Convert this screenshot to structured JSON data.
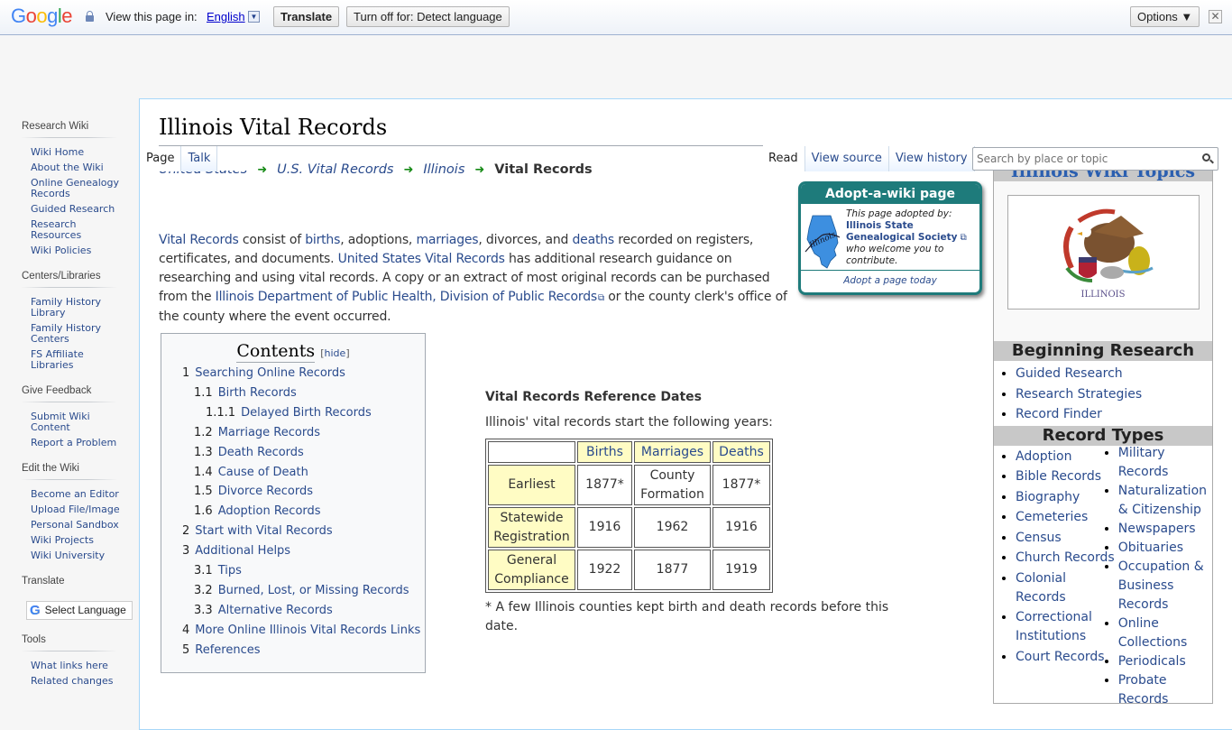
{
  "translate_bar": {
    "logo": [
      "G",
      "o",
      "o",
      "g",
      "l",
      "e"
    ],
    "view_label": "View this page in:",
    "language": "English",
    "dropdown_glyph": "▼",
    "translate_button": "Translate",
    "turn_off_button": "Turn off for: Detect language",
    "options_button": "Options ▼",
    "close_glyph": "✕"
  },
  "sidebar": {
    "sections": [
      {
        "heading": "Research Wiki",
        "items": [
          "Wiki Home",
          "About the Wiki",
          "Online Genealogy Records",
          "Guided Research",
          "Research Resources",
          "Wiki Policies"
        ]
      },
      {
        "heading": "Centers/Libraries",
        "items": [
          "Family History Library",
          "Family History Centers",
          "FS Affiliate Libraries"
        ]
      },
      {
        "heading": "Give Feedback",
        "items": [
          "Submit Wiki Content",
          "Report a Problem"
        ]
      },
      {
        "heading": "Edit the Wiki",
        "items": [
          "Become an Editor",
          "Upload File/Image",
          "Personal Sandbox",
          "Wiki Projects",
          "Wiki University"
        ]
      },
      {
        "heading": "Translate",
        "widget_label": "Select Language"
      },
      {
        "heading": "Tools",
        "items": [
          "What links here",
          "Related changes"
        ]
      }
    ]
  },
  "page": {
    "title": "Illinois Vital Records",
    "tabs_left": [
      "Page",
      "Talk"
    ],
    "tabs_right": [
      "Read",
      "View source",
      "View history"
    ],
    "search_placeholder": "Search by place or topic",
    "breadcrumb": [
      "United States",
      "U.S. Vital Records",
      "Illinois"
    ],
    "breadcrumb_current": "Vital Records",
    "breadcrumb_separator": "➜"
  },
  "intro": {
    "segments": [
      {
        "t": "Vital Records",
        "link": true
      },
      {
        "t": " consist of ",
        "link": false
      },
      {
        "t": "births",
        "link": true
      },
      {
        "t": ", adoptions, ",
        "link": false
      },
      {
        "t": "marriages",
        "link": true
      },
      {
        "t": ", divorces, and ",
        "link": false
      },
      {
        "t": "deaths",
        "link": true
      },
      {
        "t": " recorded on registers, certificates, and documents. ",
        "link": false
      },
      {
        "t": "United States Vital Records",
        "link": true
      },
      {
        "t": " has additional research guidance on researching and using vital records. A copy or an extract of most original records can be purchased from the ",
        "link": false
      },
      {
        "t": "Illinois Department of Public Health, Division of Public Records",
        "link": true,
        "external": true
      },
      {
        "t": " or the county clerk's office of the county where the event occurred.",
        "link": false
      }
    ]
  },
  "adopt": {
    "heading": "Adopt-a-wiki page",
    "line1": "This page adopted by:",
    "org": "Illinois State Genealogical Society",
    "line2": "who welcome you to contribute.",
    "footer": "Adopt a page today",
    "map_color": "#3d8fe0"
  },
  "topics": {
    "heading": "Illinois Wiki Topics",
    "seal_caption": "ILLINOIS",
    "beginning_heading": "Beginning Research",
    "beginning_items": [
      "Guided Research",
      "Research Strategies",
      "Record Finder"
    ],
    "record_types_heading": "Record Types",
    "record_types_col1": [
      "Adoption",
      "Bible Records",
      "Biography",
      "Cemeteries",
      "Census",
      "Church Records",
      "Colonial Records",
      "Correctional Institutions",
      "Court Records"
    ],
    "record_types_col2": [
      "Military Records",
      "Naturalization & Citizenship",
      "Newspapers",
      "Obituaries",
      "Occupation & Business Records",
      "Online Collections",
      "Periodicals",
      "Probate Records"
    ]
  },
  "toc": {
    "title": "Contents",
    "hide_label": "hide",
    "items": [
      {
        "num": "1",
        "label": "Searching Online Records",
        "level": 1
      },
      {
        "num": "1.1",
        "label": "Birth Records",
        "level": 2
      },
      {
        "num": "1.1.1",
        "label": "Delayed Birth Records",
        "level": 3
      },
      {
        "num": "1.2",
        "label": "Marriage Records",
        "level": 2
      },
      {
        "num": "1.3",
        "label": "Death Records",
        "level": 2
      },
      {
        "num": "1.4",
        "label": "Cause of Death",
        "level": 2
      },
      {
        "num": "1.5",
        "label": "Divorce Records",
        "level": 2
      },
      {
        "num": "1.6",
        "label": "Adoption Records",
        "level": 2
      },
      {
        "num": "2",
        "label": "Start with Vital Records",
        "level": 1
      },
      {
        "num": "3",
        "label": "Additional Helps",
        "level": 1
      },
      {
        "num": "3.1",
        "label": "Tips",
        "level": 2
      },
      {
        "num": "3.2",
        "label": "Burned, Lost, or Missing Records",
        "level": 2
      },
      {
        "num": "3.3",
        "label": "Alternative Records",
        "level": 2
      },
      {
        "num": "4",
        "label": "More Online Illinois Vital Records Links",
        "level": 1
      },
      {
        "num": "5",
        "label": "References",
        "level": 1
      }
    ]
  },
  "reference": {
    "title": "Vital Records Reference Dates",
    "subtitle": "Illinois' vital records start the following years:",
    "columns": [
      "Births",
      "Marriages",
      "Deaths"
    ],
    "rows": [
      {
        "label": "Earliest",
        "values": [
          "1877*",
          "County Formation",
          "1877*"
        ]
      },
      {
        "label": "Statewide Registration",
        "values": [
          "1916",
          "1962",
          "1916"
        ]
      },
      {
        "label": "General Compliance",
        "values": [
          "1922",
          "1877",
          "1919"
        ]
      }
    ],
    "footnote": "* A few Illinois counties kept birth and death records before this date.",
    "header_bg": "#fffcc4"
  }
}
